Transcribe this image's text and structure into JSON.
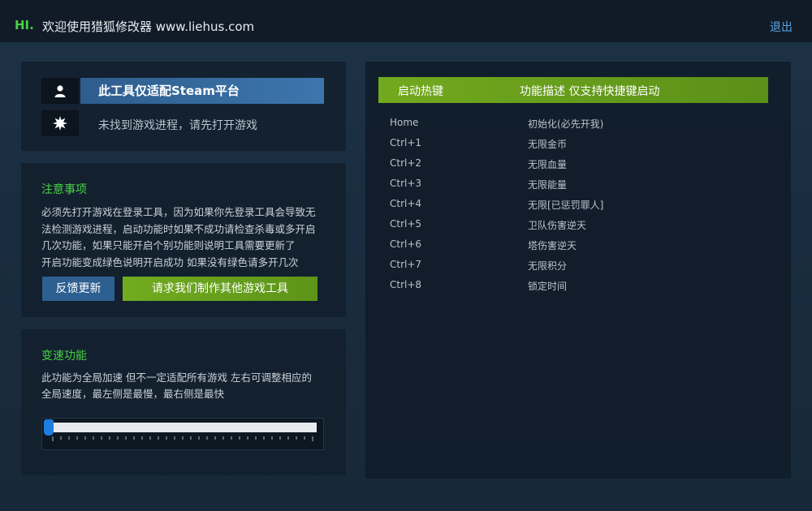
{
  "header": {
    "hi": "HI.",
    "welcome": "欢迎使用猎狐修改器 www.liehus.com",
    "logout": "退出"
  },
  "platform": {
    "banner": "此工具仅适配Steam平台",
    "status": "未找到游戏进程，请先打开游戏",
    "user_icon": "user-icon",
    "status_icon": "gear-burst-icon"
  },
  "notice": {
    "title": "注意事项",
    "lines": [
      "必须先打开游戏在登录工具，因为如果你先登录工具会导致无",
      "法检测游戏进程，启动功能时如果不成功请检查杀毒或多开启",
      "几次功能，如果只能开启个别功能则说明工具需要更新了",
      "开启功能变成绿色说明开启成功 如果没有绿色请多开几次"
    ],
    "feedback_label": "反馈更新",
    "request_label": "请求我们制作其他游戏工具"
  },
  "speed": {
    "title": "变速功能",
    "lines": [
      "此功能为全局加速 但不一定适配所有游戏 左右可调整相应的",
      "全局速度，最左侧是最慢，最右侧是最快"
    ],
    "slider_value": 0,
    "tick_count": 33
  },
  "hotkeys": {
    "header_key": "启动热键",
    "header_desc": "功能描述 仅支持快捷键启动",
    "rows": [
      {
        "key": "Home",
        "desc": "初始化(必先开我)"
      },
      {
        "key": "Ctrl+1",
        "desc": "无限金币"
      },
      {
        "key": "Ctrl+2",
        "desc": "无限血量"
      },
      {
        "key": "Ctrl+3",
        "desc": "无限能量"
      },
      {
        "key": "Ctrl+4",
        "desc": "无限[已惩罚罪人]"
      },
      {
        "key": "Ctrl+5",
        "desc": "卫队伤害逆天"
      },
      {
        "key": "Ctrl+6",
        "desc": "塔伤害逆天"
      },
      {
        "key": "Ctrl+7",
        "desc": "无限积分"
      },
      {
        "key": "Ctrl+8",
        "desc": "锁定时间"
      }
    ]
  },
  "colors": {
    "accent_green": "#48d144",
    "button_blue": "#2d5f91",
    "button_green": "#6aa31d",
    "link_blue": "#5aa6e6"
  }
}
